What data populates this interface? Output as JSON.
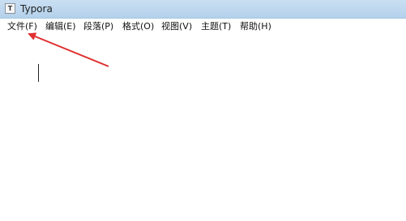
{
  "window": {
    "app_icon": "T",
    "title": "Typora"
  },
  "menubar": {
    "items": [
      {
        "label": "文件(F)"
      },
      {
        "label": "编辑(E)"
      },
      {
        "label": "段落(P)"
      },
      {
        "label": "格式(O)"
      },
      {
        "label": "视图(V)"
      },
      {
        "label": "主题(T)"
      },
      {
        "label": "帮助(H)"
      }
    ]
  },
  "annotation": {
    "arrow_color": "#e03030",
    "target": "menu-file"
  }
}
